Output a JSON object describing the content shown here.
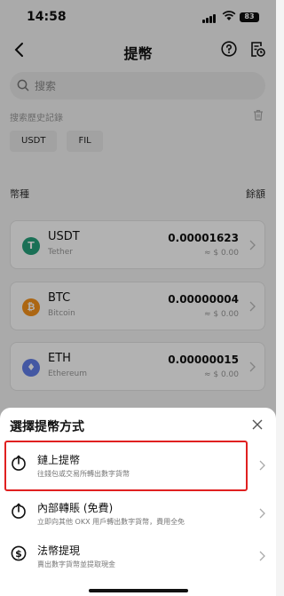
{
  "status": {
    "time": "14:58",
    "battery": "83"
  },
  "header": {
    "title": "提幣"
  },
  "search": {
    "placeholder": "搜索"
  },
  "history": {
    "label": "搜索歷史記錄",
    "chips": [
      "USDT",
      "FIL"
    ]
  },
  "columns": {
    "left": "幣種",
    "right": "餘額"
  },
  "coins": [
    {
      "symbol": "USDT",
      "name": "Tether",
      "balance": "0.00001623",
      "fiat": "≈ $ 0.00",
      "color": "#26a17b",
      "icon_glyph": "T"
    },
    {
      "symbol": "BTC",
      "name": "Bitcoin",
      "balance": "0.00000004",
      "fiat": "≈ $ 0.00",
      "color": "#f7931a",
      "icon_glyph": "₿"
    },
    {
      "symbol": "ETH",
      "name": "Ethereum",
      "balance": "0.00000015",
      "fiat": "≈ $ 0.00",
      "color": "#627eea",
      "icon_glyph": "♦"
    }
  ],
  "sheet": {
    "title": "選擇提幣方式",
    "options": [
      {
        "name": "鏈上提幣",
        "desc": "往錢包或交易所轉出數字貨幣",
        "icon": "power-upload-icon"
      },
      {
        "name": "內部轉賬 (免費)",
        "desc": "立即向其他 OKX 用戶轉出數字貨幣，費用全免",
        "icon": "power-upload-icon"
      },
      {
        "name": "法幣提現",
        "desc": "賣出數字貨幣並提取現金",
        "icon": "dollar-circle-icon"
      }
    ]
  },
  "colors": {
    "highlight": "#e02020"
  }
}
